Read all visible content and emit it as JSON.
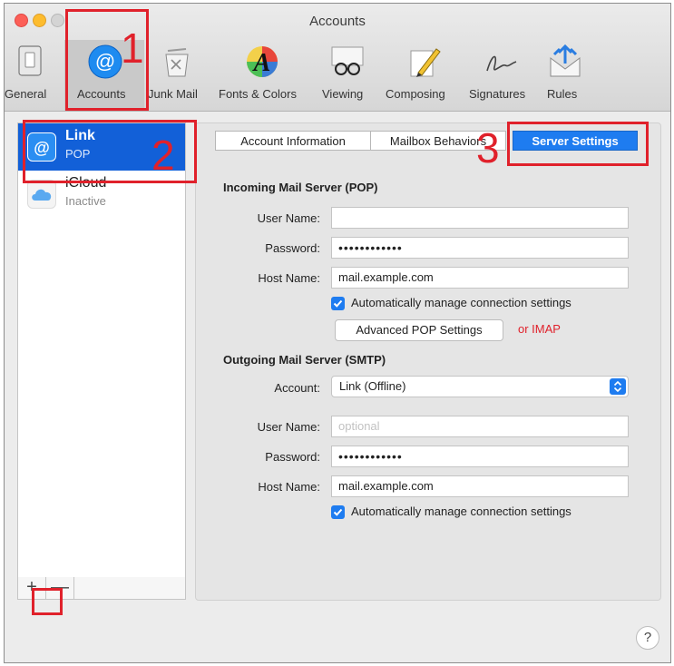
{
  "window": {
    "title": "Accounts"
  },
  "toolbar": {
    "items": [
      {
        "label": "General",
        "icon": "general-icon"
      },
      {
        "label": "Accounts",
        "icon": "at-sign-icon"
      },
      {
        "label": "Junk Mail",
        "icon": "junk-mail-icon"
      },
      {
        "label": "Fonts & Colors",
        "icon": "fonts-colors-icon"
      },
      {
        "label": "Viewing",
        "icon": "glasses-icon"
      },
      {
        "label": "Composing",
        "icon": "pencil-icon"
      },
      {
        "label": "Signatures",
        "icon": "signature-icon"
      },
      {
        "label": "Rules",
        "icon": "rules-icon"
      }
    ]
  },
  "annotations": {
    "n1": "1",
    "n2": "2",
    "n3": "3",
    "color": "#e0212b"
  },
  "sidebar": {
    "accounts": [
      {
        "name": "Link",
        "subtitle": "POP",
        "selected": true
      },
      {
        "name": "iCloud",
        "subtitle": "Inactive",
        "selected": false
      }
    ],
    "add_label": "+",
    "remove_label": "—"
  },
  "tabs": [
    {
      "label": "Account Information"
    },
    {
      "label": "Mailbox Behaviors"
    },
    {
      "label": "Server Settings",
      "selected": true
    }
  ],
  "incoming": {
    "heading": "Incoming Mail Server (POP)",
    "user_label": "User Name:",
    "user_value": "",
    "password_label": "Password:",
    "password_value": "••••••••••••",
    "host_label": "Host Name:",
    "host_value": "mail.example.com",
    "auto_label": "Automatically manage connection settings",
    "advanced_button": "Advanced POP Settings",
    "or_imap": "or IMAP"
  },
  "outgoing": {
    "heading": "Outgoing Mail Server (SMTP)",
    "account_label": "Account:",
    "account_value": "Link (Offline)",
    "user_label": "User Name:",
    "user_placeholder": "optional",
    "password_label": "Password:",
    "password_value": "••••••••••••",
    "host_label": "Host Name:",
    "host_value": "mail.example.com",
    "auto_label": "Automatically manage connection settings"
  },
  "help": {
    "label": "?"
  },
  "colors": {
    "accent": "#1e7cf0",
    "selection": "#1260d8",
    "annotation": "#e0212b"
  }
}
